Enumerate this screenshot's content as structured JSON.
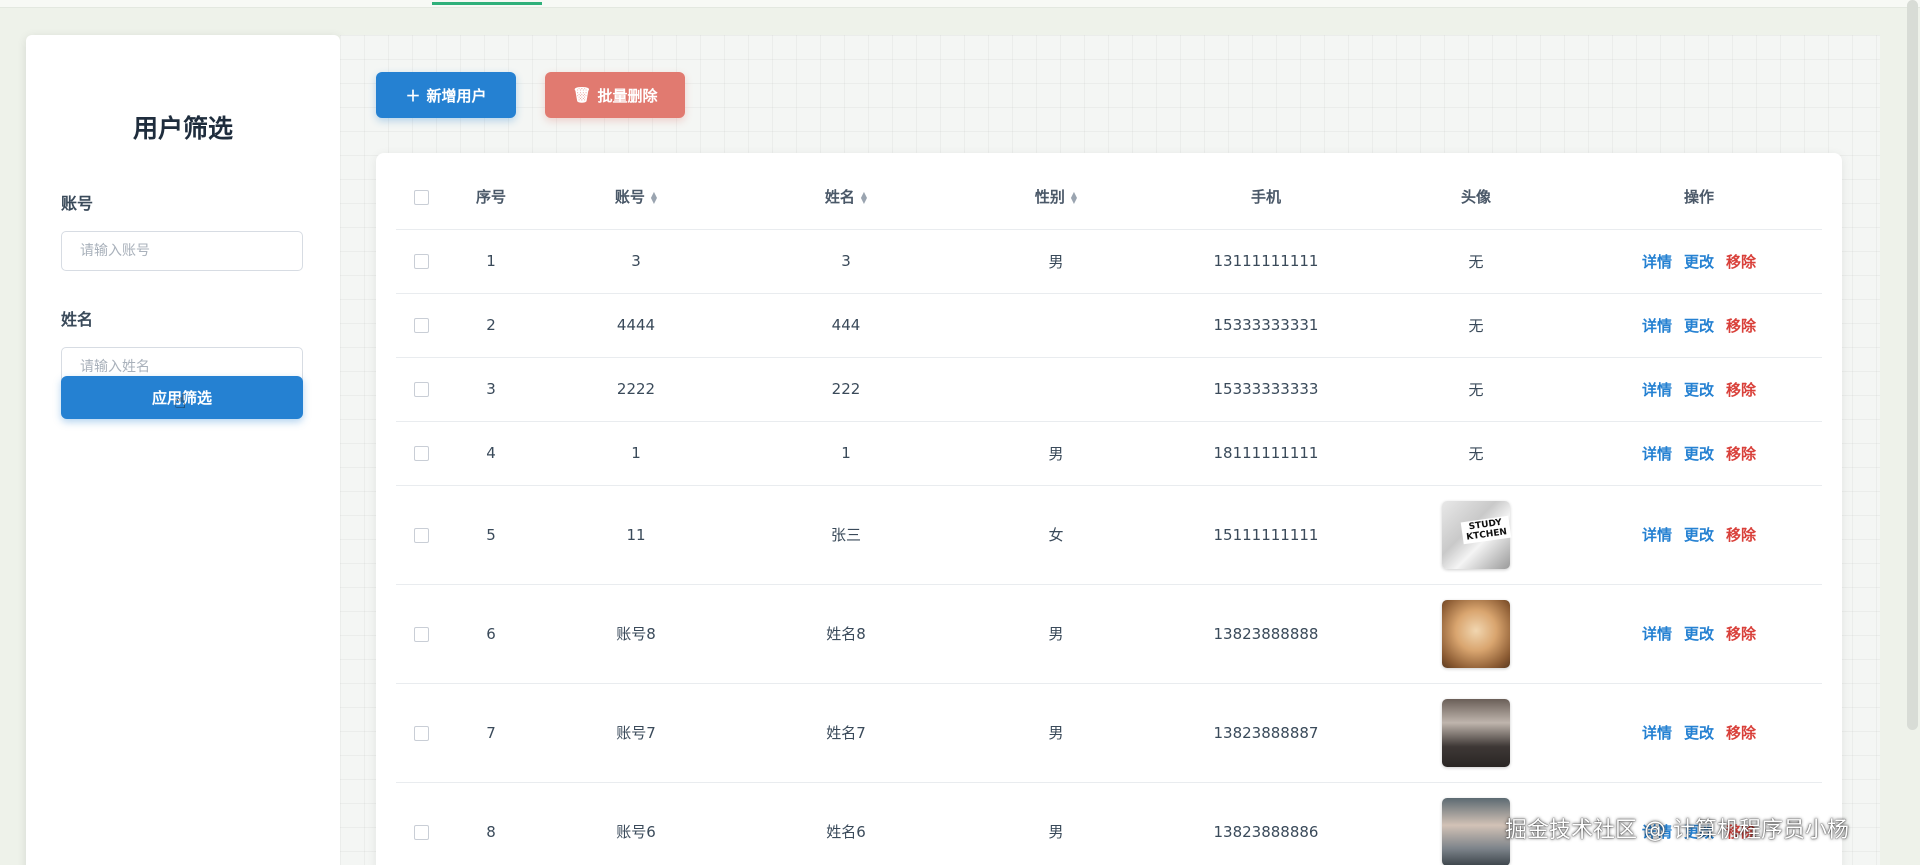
{
  "sidebar": {
    "title": "用户筛选",
    "account_label": "账号",
    "account_placeholder": "请输入账号",
    "name_label": "姓名",
    "name_placeholder": "请输入姓名",
    "apply_label": "应用筛选"
  },
  "toolbar": {
    "add_icon": "plus-icon",
    "add_label": "新增用户",
    "delete_icon": "trash-icon",
    "delete_label": "批量删除"
  },
  "table": {
    "headers": {
      "index": "序号",
      "account": "账号",
      "name": "姓名",
      "gender": "性别",
      "phone": "手机",
      "avatar": "头像",
      "actions": "操作"
    },
    "action_labels": {
      "detail": "详情",
      "edit": "更改",
      "remove": "移除"
    },
    "rows": [
      {
        "index": "1",
        "account": "3",
        "name": "3",
        "gender": "男",
        "phone": "13111111111",
        "avatar": "无"
      },
      {
        "index": "2",
        "account": "4444",
        "name": "444",
        "gender": "",
        "phone": "15333333331",
        "avatar": "无"
      },
      {
        "index": "3",
        "account": "2222",
        "name": "222",
        "gender": "",
        "phone": "15333333333",
        "avatar": "无"
      },
      {
        "index": "4",
        "account": "1",
        "name": "1",
        "gender": "男",
        "phone": "18111111111",
        "avatar": "无"
      },
      {
        "index": "5",
        "account": "11",
        "name": "张三",
        "gender": "女",
        "phone": "15111111111",
        "avatar_image_text": "STUDY KTCHEN"
      },
      {
        "index": "6",
        "account": "账号8",
        "name": "姓名8",
        "gender": "男",
        "phone": "13823888888"
      },
      {
        "index": "7",
        "account": "账号7",
        "name": "姓名7",
        "gender": "男",
        "phone": "13823888887"
      },
      {
        "index": "8",
        "account": "账号6",
        "name": "姓名6",
        "gender": "男",
        "phone": "13823888886"
      }
    ]
  },
  "watermark": "掘金技术社区 @ 计算机程序员小杨",
  "colors": {
    "primary": "#2581d2",
    "danger": "#e17a70",
    "remove_text": "#d9403a"
  }
}
